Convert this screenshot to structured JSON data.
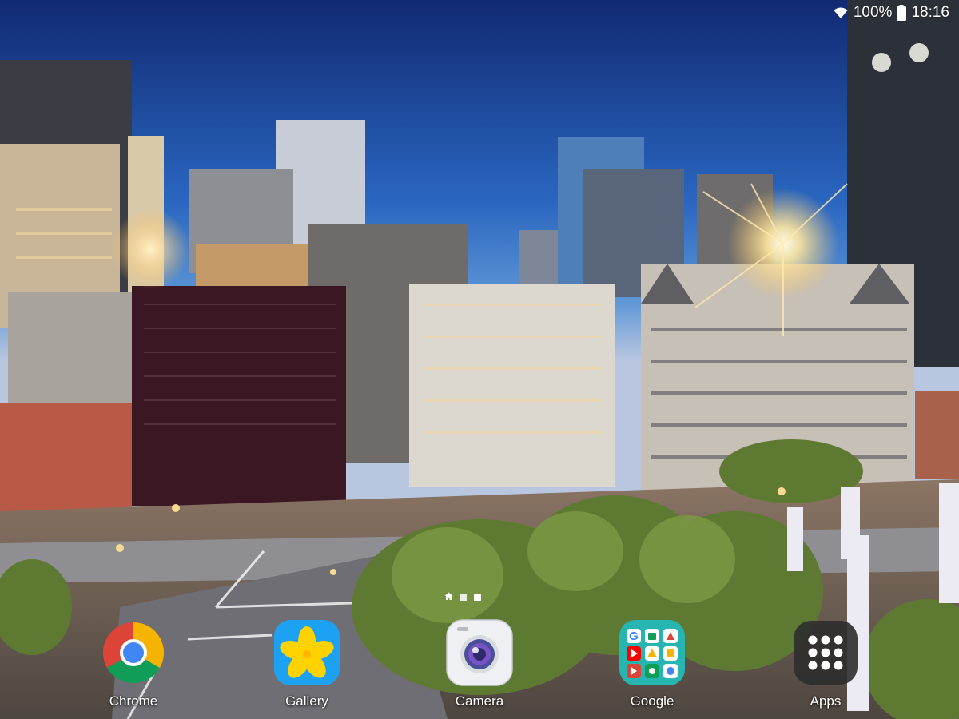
{
  "status_bar": {
    "battery_percent": "100%",
    "time": "18:16",
    "icons": [
      "wifi-icon",
      "battery-icon"
    ]
  },
  "page_indicator": {
    "dots": [
      "home-icon",
      "page-dot",
      "page-dot"
    ],
    "active_index": 2
  },
  "dock": {
    "apps": [
      {
        "label": "Chrome",
        "icon": "chrome-icon"
      },
      {
        "label": "Gallery",
        "icon": "gallery-icon"
      },
      {
        "label": "Camera",
        "icon": "camera-icon"
      },
      {
        "label": "Google",
        "icon": "google-folder-icon"
      },
      {
        "label": "Apps",
        "icon": "apps-grid-icon"
      }
    ]
  },
  "colors": {
    "sky_top": "#13307a",
    "sky_mid": "#3f83d0",
    "horizon": "#c9a37a",
    "chrome_red": "#DB4437",
    "chrome_yellow": "#F4B400",
    "chrome_green": "#0F9D58",
    "chrome_blue": "#4285F4",
    "gallery_blue": "#1da1f2",
    "gallery_yellow": "#ffd200",
    "google_folder": "#26b5b0"
  }
}
